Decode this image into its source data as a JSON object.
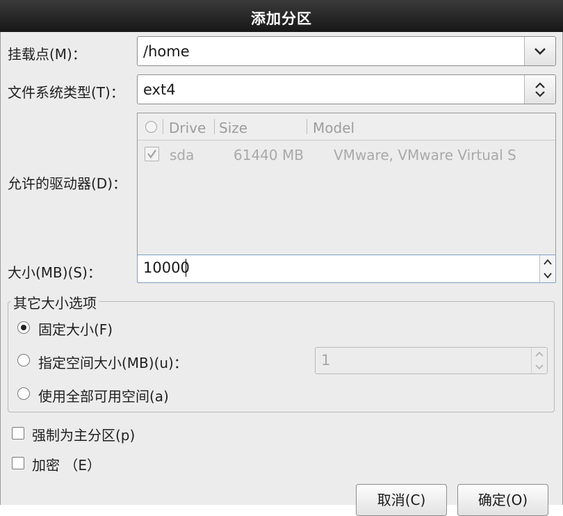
{
  "window": {
    "background_title": "",
    "title": "添加分区"
  },
  "mount_point": {
    "label": "挂载点(M)：",
    "value": "/home",
    "dropdown_icon": "chevron-down-icon"
  },
  "fs_type": {
    "label": "文件系统类型(T)：",
    "value": "ext4",
    "spinner_icon": "updown-icon"
  },
  "drives": {
    "label": "允许的驱动器(D)：",
    "columns": [
      "Drive",
      "Size",
      "Model"
    ],
    "rows": [
      {
        "checked": true,
        "drive": "sda",
        "size": "61440 MB",
        "model": "VMware, VMware Virtual S"
      }
    ]
  },
  "size": {
    "label": "大小(MB)(S)：",
    "value": "10000"
  },
  "size_options": {
    "title": "其它大小选项",
    "options": [
      {
        "label": "固定大小(F)",
        "selected": true
      },
      {
        "label": "指定空间大小(MB)(u)：",
        "selected": false
      },
      {
        "label": "使用全部可用空间(a)",
        "selected": false
      }
    ],
    "max_size_value": "1"
  },
  "force_primary": {
    "label": "强制为主分区(p)",
    "checked": false
  },
  "encrypt": {
    "label": "加密 （E）",
    "checked": false
  },
  "buttons": {
    "cancel": "取消(C)",
    "ok": "确定(O)"
  },
  "colors": {
    "titlebar": "#1f1f1f",
    "dialog_bg": "#ececec",
    "focus_border": "#7f9fc4"
  }
}
